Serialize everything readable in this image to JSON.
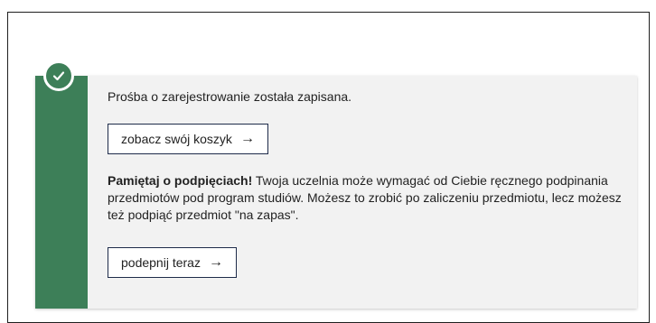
{
  "notification": {
    "status_message": "Prośba o zarejestrowanie została zapisana.",
    "cart_button_label": "zobacz swój koszyk",
    "reminder_title": "Pamiętaj o podpięciach!",
    "reminder_body": " Twoja uczelnia może wymagać od Ciebie ręcznego podpinania przedmiotów pod program studiów. Możesz to zrobić po zaliczeniu przedmiotu, lecz możesz też podpiąć przedmiot \"na zapas\".",
    "attach_button_label": "podepnij teraz",
    "arrow_glyph": "→",
    "icon": "check-circle-icon",
    "accent_color": "#3d7f58",
    "background_color": "#f2f2f2"
  }
}
